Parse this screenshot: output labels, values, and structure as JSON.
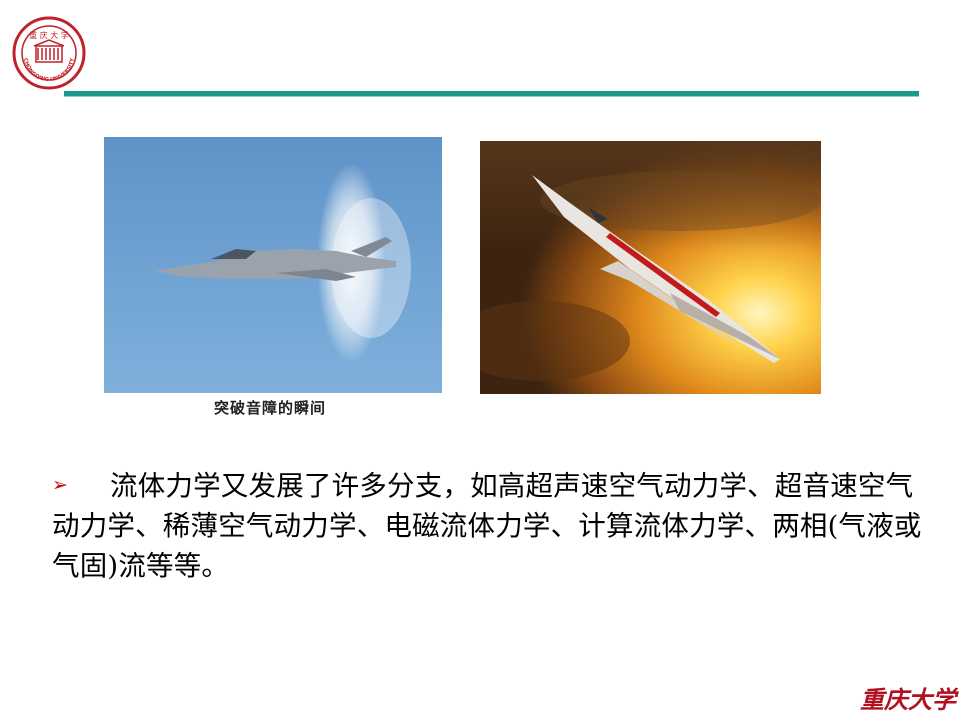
{
  "header": {
    "logo_name": "Chongqing University seal",
    "logo_text": "CHONGQING UNIVERSITY",
    "logo_color": "#c0222a",
    "rule_color": "#1a9a8c"
  },
  "images": {
    "left_caption": "突破音障的瞬间"
  },
  "content": {
    "bullet_symbol": "➢",
    "paragraph": "流体力学又发展了许多分支，如高超声速空气动力学、超音速空气动力学、稀薄空气动力学、电磁流体力学、计算流体力学、两相(气液或气固)流等等。"
  },
  "footer": {
    "calligraphy_text": "重庆大学",
    "calligraphy_color": "#b01020"
  }
}
